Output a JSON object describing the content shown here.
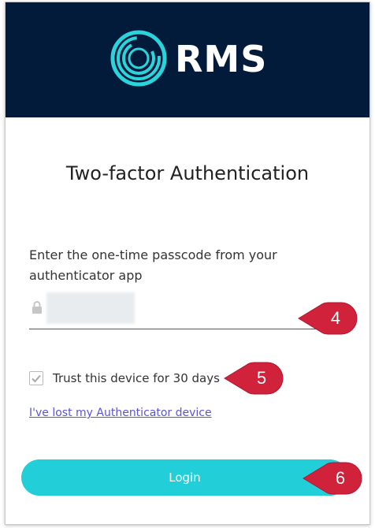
{
  "brand": {
    "name": "RMS",
    "header_color": "#031b3a",
    "accent_color": "#22cfd8"
  },
  "page": {
    "title": "Two-factor Authentication",
    "instruction": "Enter the one-time passcode from your authenticator app"
  },
  "passcode_field": {
    "icon": "lock-icon",
    "value": "",
    "obscured": true
  },
  "trust_device": {
    "label": "Trust this device for 30 days",
    "checked": true
  },
  "lost_device_link": {
    "label": "I've lost my Authenticator device",
    "color": "#5a55d6"
  },
  "login_button": {
    "label": "Login"
  },
  "callouts": {
    "color": "#d0223a",
    "passcode": "4",
    "trust": "5",
    "login": "6"
  }
}
